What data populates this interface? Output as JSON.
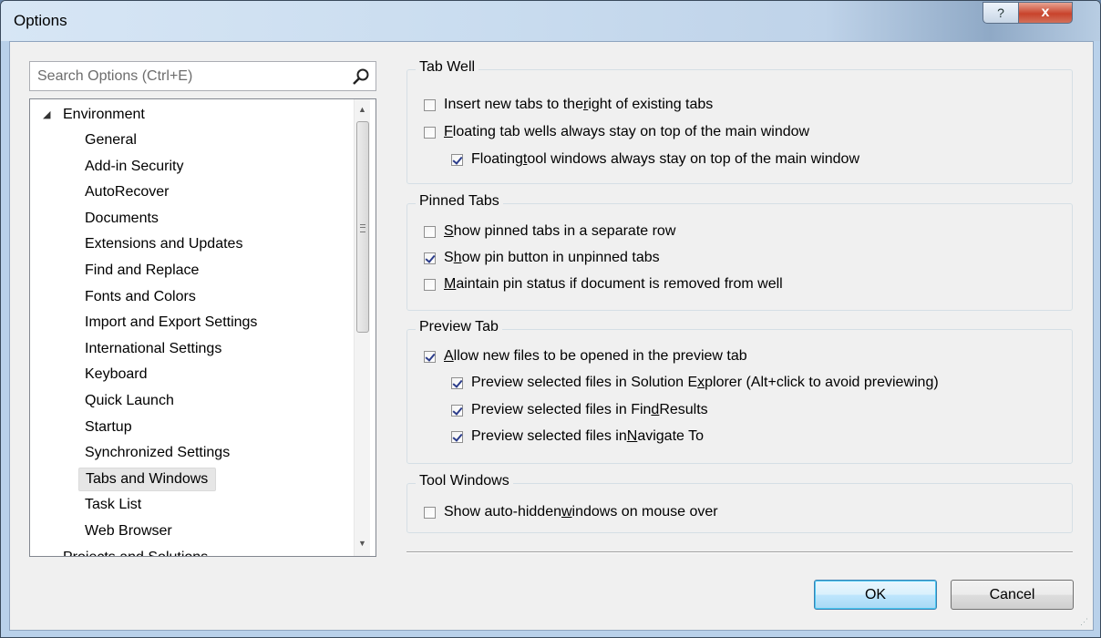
{
  "window": {
    "title": "Options"
  },
  "titlebar": {
    "help_label": "?",
    "close_label": "x"
  },
  "search": {
    "placeholder": "Search Options (Ctrl+E)"
  },
  "tree": {
    "root_label": "Environment",
    "items": [
      {
        "label": "General"
      },
      {
        "label": "Add-in Security"
      },
      {
        "label": "AutoRecover"
      },
      {
        "label": "Documents"
      },
      {
        "label": "Extensions and Updates"
      },
      {
        "label": "Find and Replace"
      },
      {
        "label": "Fonts and Colors"
      },
      {
        "label": "Import and Export Settings"
      },
      {
        "label": "International Settings"
      },
      {
        "label": "Keyboard"
      },
      {
        "label": "Quick Launch"
      },
      {
        "label": "Startup"
      },
      {
        "label": "Synchronized Settings"
      },
      {
        "label": "Tabs and Windows",
        "selected": true
      },
      {
        "label": "Task List"
      },
      {
        "label": "Web Browser"
      }
    ],
    "partial_label": "Projects and Solutions"
  },
  "groups": {
    "tab_well": {
      "label": "Tab Well",
      "options": [
        {
          "pre": "Insert new tabs to the ",
          "ul": "r",
          "post": "ight of existing tabs",
          "checked": false
        },
        {
          "pre": "",
          "ul": "F",
          "post": "loating tab wells always stay on top of the main window",
          "checked": false
        },
        {
          "pre": "Floating ",
          "ul": "t",
          "post": "ool windows always stay on top of the main window",
          "checked": true
        }
      ]
    },
    "pinned_tabs": {
      "label": "Pinned Tabs",
      "options": [
        {
          "pre": "",
          "ul": "S",
          "post": "how pinned tabs in a separate row",
          "checked": false
        },
        {
          "pre": "S",
          "ul": "h",
          "post": "ow pin button in unpinned tabs",
          "checked": true
        },
        {
          "pre": "",
          "ul": "M",
          "post": "aintain pin status if document is removed from well",
          "checked": false
        }
      ]
    },
    "preview_tab": {
      "label": "Preview Tab",
      "options": [
        {
          "pre": "",
          "ul": "A",
          "post": "llow new files to be opened in the preview tab",
          "checked": true
        },
        {
          "pre": "Preview selected files in Solution E",
          "ul": "x",
          "post": "plorer (Alt+click to avoid previewing)",
          "checked": true
        },
        {
          "pre": "Preview selected files in Fin",
          "ul": "d",
          "post": " Results",
          "checked": true
        },
        {
          "pre": "Preview selected files in ",
          "ul": "N",
          "post": "avigate To",
          "checked": true
        }
      ]
    },
    "tool_windows": {
      "label": "Tool Windows",
      "options": [
        {
          "pre": "Show auto-hidden ",
          "ul": "w",
          "post": "indows on mouse over",
          "checked": false
        }
      ]
    }
  },
  "buttons": {
    "ok": "OK",
    "cancel": "Cancel"
  }
}
